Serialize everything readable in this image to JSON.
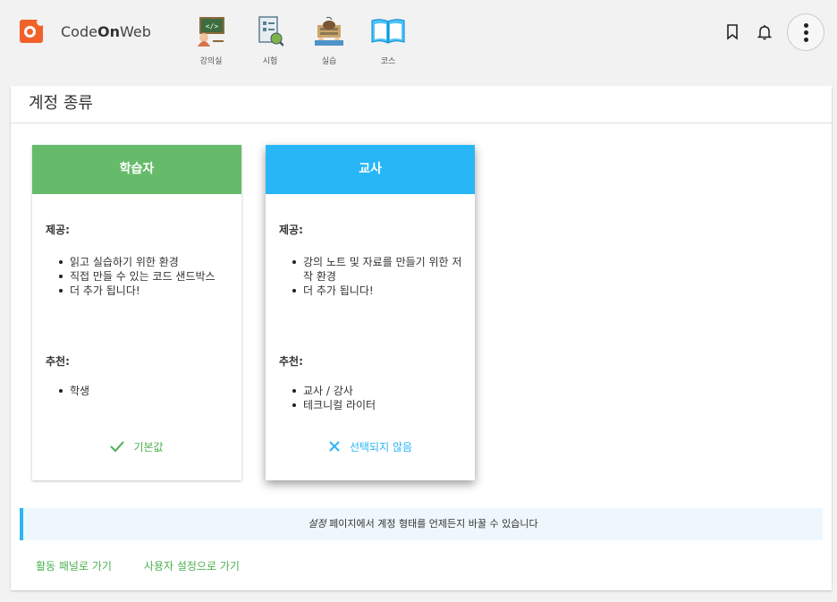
{
  "header": {
    "logo": {
      "prefix": "Code",
      "bold": "On",
      "suffix": "Web"
    },
    "nav": [
      {
        "label": "강의실",
        "icon": "classroom-icon"
      },
      {
        "label": "시험",
        "icon": "exam-icon"
      },
      {
        "label": "실습",
        "icon": "practice-icon"
      },
      {
        "label": "코스",
        "icon": "course-book-icon"
      }
    ],
    "actions": [
      "bookmark-icon",
      "bell-icon",
      "more-vert-icon"
    ]
  },
  "page": {
    "title": "계정 종류"
  },
  "cards": [
    {
      "title": "학습자",
      "color": "#66bb6a",
      "provides_label": "제공:",
      "provides": [
        "읽고 실습하기 위한 환경",
        "직접 만들 수 있는 코드 샌드박스",
        "더 추가 됩니다!"
      ],
      "recommended_label": "추천:",
      "recommended": [
        "학생"
      ],
      "status_label": "기본값",
      "status_icon": "check-icon"
    },
    {
      "title": "교사",
      "color": "#29b6f6",
      "provides_label": "제공:",
      "provides": [
        "강의 노트 및 자료를 만들기 위한 저작 환경",
        "더 추가 됩니다!"
      ],
      "recommended_label": "추천:",
      "recommended": [
        "교사 / 강사",
        "테크니컬 라이터"
      ],
      "status_label": "선택되지 않음",
      "status_icon": "close-icon"
    }
  ],
  "notice": {
    "emphasis": "설정",
    "text": " 페이지에서 계정 형태를 언제든지 바꿀 수 있습니다"
  },
  "links": {
    "dashboard": "활동 패널로 가기",
    "settings": "사용자 설정으로 가기"
  }
}
